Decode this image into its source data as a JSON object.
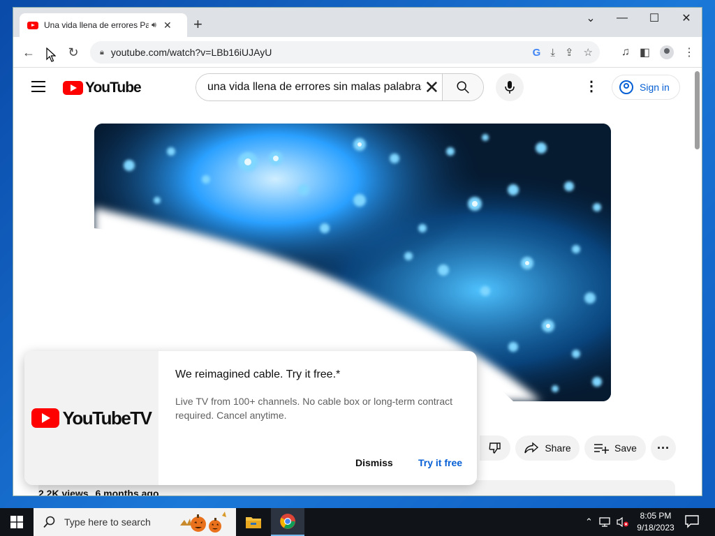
{
  "browser": {
    "tab_title": "Una vida llena de errores Par",
    "address": "youtube.com/watch?v=LBb16iUJAyU"
  },
  "youtube": {
    "logo_text": "YouTube",
    "search_value": "una vida llena de errores sin malas palabras",
    "signin_label": "Sign in",
    "actions": {
      "share_label": "Share",
      "save_label": "Save"
    },
    "meta": {
      "views": "2.2K views",
      "age": "6 months ago"
    }
  },
  "promo": {
    "logo_text": "YouTubeTV",
    "title": "We reimagined cable. Try it free.*",
    "body": "Live TV from 100+ channels. No cable box or long-term contract required. Cancel anytime.",
    "dismiss_label": "Dismiss",
    "try_label": "Try it free"
  },
  "taskbar": {
    "search_placeholder": "Type here to search",
    "time": "8:05 PM",
    "date": "9/18/2023"
  },
  "colors": {
    "accent_blue": "#065fd4",
    "yt_red": "#ff0000"
  }
}
